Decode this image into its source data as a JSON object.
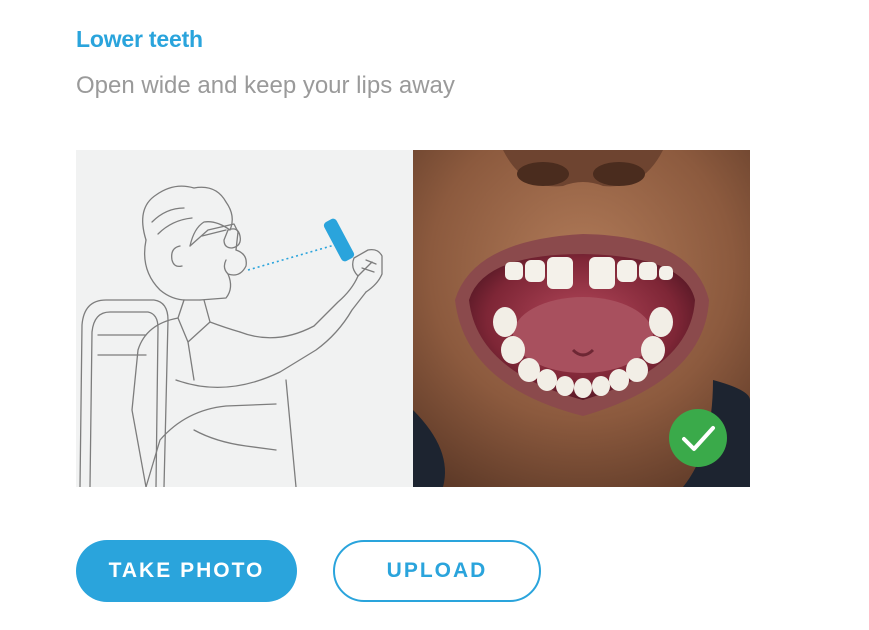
{
  "header": {
    "title": "Lower teeth",
    "subtitle": "Open wide and keep your lips away"
  },
  "actions": {
    "take_photo_label": "TAKE PHOTO",
    "upload_label": "UPLOAD"
  },
  "icons": {
    "check": "check-icon"
  },
  "colors": {
    "accent": "#2aa4dc",
    "subtitle": "#9a9a9a",
    "success": "#3aaa4a",
    "illustration_bg": "#f1f2f2"
  }
}
